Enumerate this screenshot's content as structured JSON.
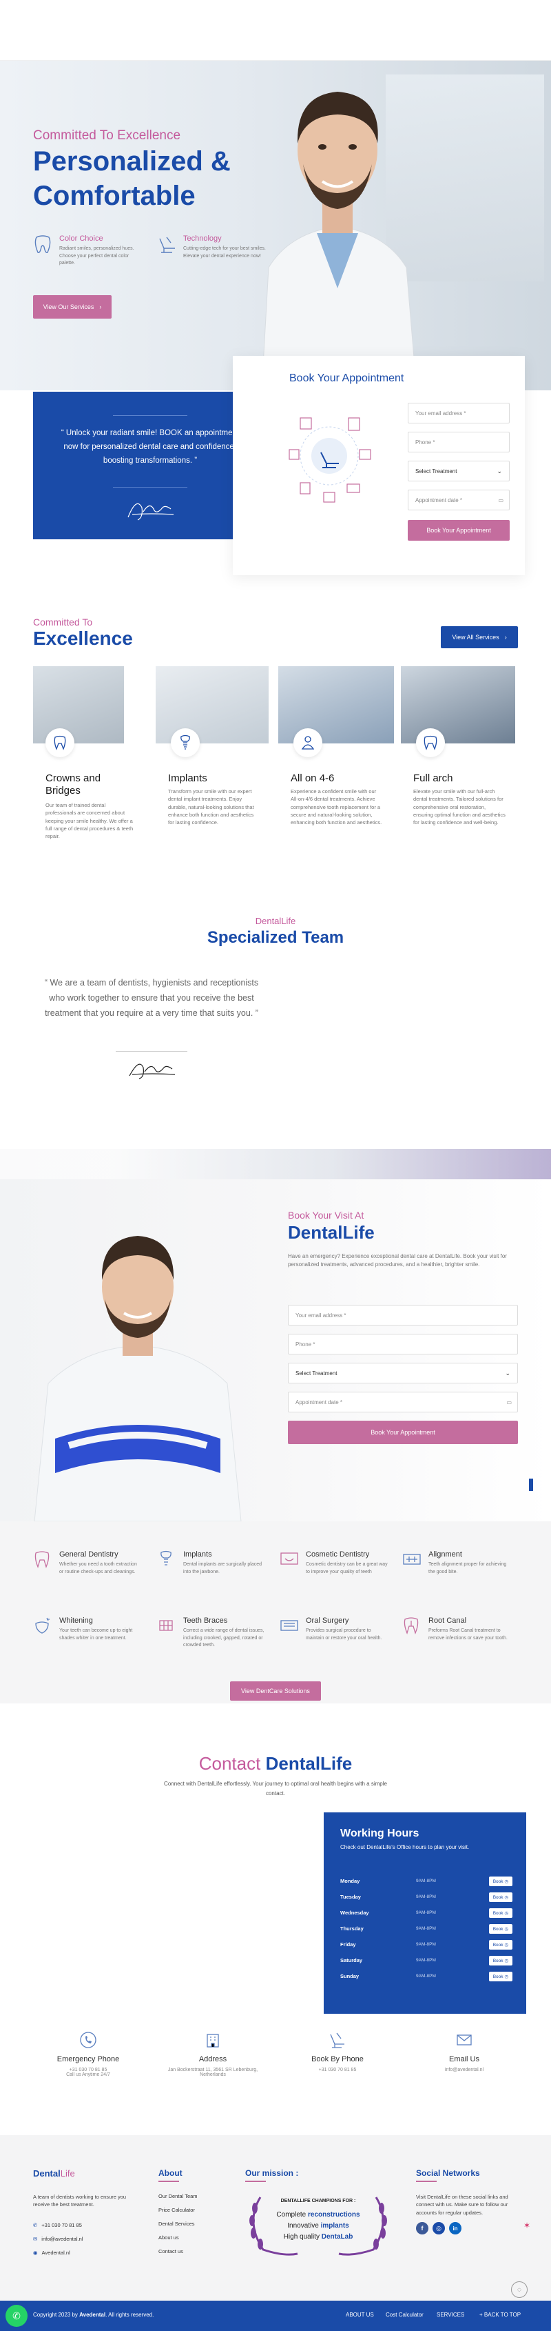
{
  "hero": {
    "eyebrow": "Committed To Excellence",
    "title_line1": "Personalized &",
    "title_line2": "Comfortable",
    "features": [
      {
        "title": "Color Choice",
        "text": "Radiant smiles, personalized hues. Choose your perfect dental color palette."
      },
      {
        "title": "Technology",
        "text": "Cutting-edge tech for your best smiles. Elevate your dental experience now!"
      }
    ],
    "cta": "View Our Services"
  },
  "quote_card": {
    "text": "Unlock your radiant smile! BOOK an appointment now for personalized dental care and confidence-boosting transformations."
  },
  "appointment": {
    "title": "Book Your Appointment",
    "email_ph": "Your email address *",
    "phone_ph": "Phone *",
    "treatment": "Select Treatment",
    "date_ph": "Appointment date *",
    "submit": "Book Your Appointment"
  },
  "excellence": {
    "eyebrow": "Committed To",
    "title": "Excellence",
    "button": "View All Services",
    "cards": [
      {
        "title": "Crowns and Bridges",
        "text": "Our team of trained dental professionals are concerned about keeping your smile healthy. We offer a full range of dental procedures & teeth repair."
      },
      {
        "title": "Implants",
        "text": "Transform your smile with our expert dental implant treatments. Enjoy durable, natural-looking solutions that enhance both function and aesthetics for lasting confidence."
      },
      {
        "title": "All on 4-6",
        "text": "Experience a confident smile with our All-on-4/6 dental treatments. Achieve comprehensive tooth replacement for a secure and natural-looking solution, enhancing both function and aesthetics."
      },
      {
        "title": "Full arch",
        "text": "Elevate your smile with our full-arch dental treatments. Tailored solutions for comprehensive oral restoration, ensuring optimal function and aesthetics for lasting confidence and well-being."
      }
    ]
  },
  "team": {
    "eyebrow": "DentalLife",
    "title": "Specialized Team",
    "quote": "We are a team of dentists, hygienists and receptionists who work together to ensure that you receive the best treatment that you require at a very time that suits you."
  },
  "visit": {
    "eyebrow": "Book Your Visit At",
    "title": "DentalLife",
    "text": "Have an emergency? Experience exceptional dental care at DentalLife. Book your visit for personalized treatments, advanced procedures, and a healthier, brighter smile.",
    "email_ph": "Your email address *",
    "phone_ph": "Phone *",
    "treatment": "Select Treatment",
    "date_ph": "Appointment date *",
    "submit": "Book Your Appointment"
  },
  "services": {
    "items": [
      {
        "title": "General Dentistry",
        "text": "Whether you need a tooth extraction or routine check-ups and cleanings.",
        "icon": "tooth-clean-icon"
      },
      {
        "title": "Implants",
        "text": "Dental implants are surgically placed into the jawbone.",
        "icon": "implant-icon"
      },
      {
        "title": "Cosmetic Dentistry",
        "text": "Cosmetic dentistry can be a great way to improve your quality of teeth",
        "icon": "cosmetic-icon"
      },
      {
        "title": "Alignment",
        "text": "Teeth alignment proper for achieving the good bite.",
        "icon": "alignment-icon"
      },
      {
        "title": "Whitening",
        "text": "Your teeth can become up to eight shades whiter in one treatment.",
        "icon": "whitening-icon"
      },
      {
        "title": "Teeth Braces",
        "text": "Correct a wide range of dental issues, including crooked, gapped, rotated or crowded teeth.",
        "icon": "braces-icon"
      },
      {
        "title": "Oral Surgery",
        "text": "Provides surgical procedure to maintain or restore your oral health.",
        "icon": "surgery-icon"
      },
      {
        "title": "Root Canal",
        "text": "Preforms Root Canal treatment to remove infections or save your tooth.",
        "icon": "root-canal-icon"
      }
    ],
    "button": "View DentCare Solutions"
  },
  "contact": {
    "title_a": "Contact",
    "title_b": "DentalLife",
    "sub": "Connect with DentalLife effortlessly. Your journey to optimal oral health begins with a simple contact.",
    "hours_title": "Working Hours",
    "hours_sub": "Check out DentalLife's Office hours to plan your visit.",
    "days": [
      {
        "day": "Monday",
        "time": "9AM-8PM",
        "btn": "Book"
      },
      {
        "day": "Tuesday",
        "time": "9AM-8PM",
        "btn": "Book"
      },
      {
        "day": "Wednesday",
        "time": "9AM-8PM",
        "btn": "Book"
      },
      {
        "day": "Thursday",
        "time": "9AM-8PM",
        "btn": "Book"
      },
      {
        "day": "Friday",
        "time": "9AM-8PM",
        "btn": "Book"
      },
      {
        "day": "Saturday",
        "time": "9AM-8PM",
        "btn": "Book"
      },
      {
        "day": "Sunday",
        "time": "9AM-8PM",
        "btn": "Book"
      }
    ],
    "cards": [
      {
        "title": "Emergency Phone",
        "line1": "+31 030 70 81 85",
        "line2": "Call us Anytime 24/7"
      },
      {
        "title": "Address",
        "line1": "Jan Bockerstraat 11, 3561 SR Lebenburg,",
        "line2": "Netherlands"
      },
      {
        "title": "Book By Phone",
        "line1": "+31 030 70 81 85",
        "line2": ""
      },
      {
        "title": "Email Us",
        "line1": "info@avedental.nl",
        "line2": ""
      }
    ]
  },
  "footer": {
    "brand_a": "Dental",
    "brand_b": "Life",
    "about_text": "A team of dentists working to ensure you receive the best treatment.",
    "phone": "+31 030 70 81 85",
    "email": "info@avedental.nl",
    "site": "Avedental.nl",
    "col2_title": "About",
    "col2_links": [
      "Our Dental Team",
      "Price Calculator",
      "Dental Services",
      "About us",
      "Contact us"
    ],
    "col3_title": "Our mission :",
    "badge_top": "DENTALLIFE CHAMPIONS FOR :",
    "badge_l1a": "Complete ",
    "badge_l1b": "reconstructions",
    "badge_l2a": "Innovative ",
    "badge_l2b": "implants",
    "badge_l3a": "High quality ",
    "badge_l3b": "DentaLab",
    "col4_title": "Social Networks",
    "col4_text": "Visit DentalLife on these social links and connect with us. Make sure to follow our accounts for regular updates."
  },
  "bottom_bar": {
    "copyright_a": "Copyright 2023 by ",
    "copyright_b": "Avedental",
    "copyright_c": ". All rights reserved.",
    "links": [
      "ABOUT US",
      "Cost Calculator",
      "SERVICES",
      "+ BACK TO TOP"
    ]
  },
  "colors": {
    "brand_blue": "#1a4ba8",
    "brand_pink": "#c46d9e",
    "bar_blue": "#1a4ba8"
  }
}
